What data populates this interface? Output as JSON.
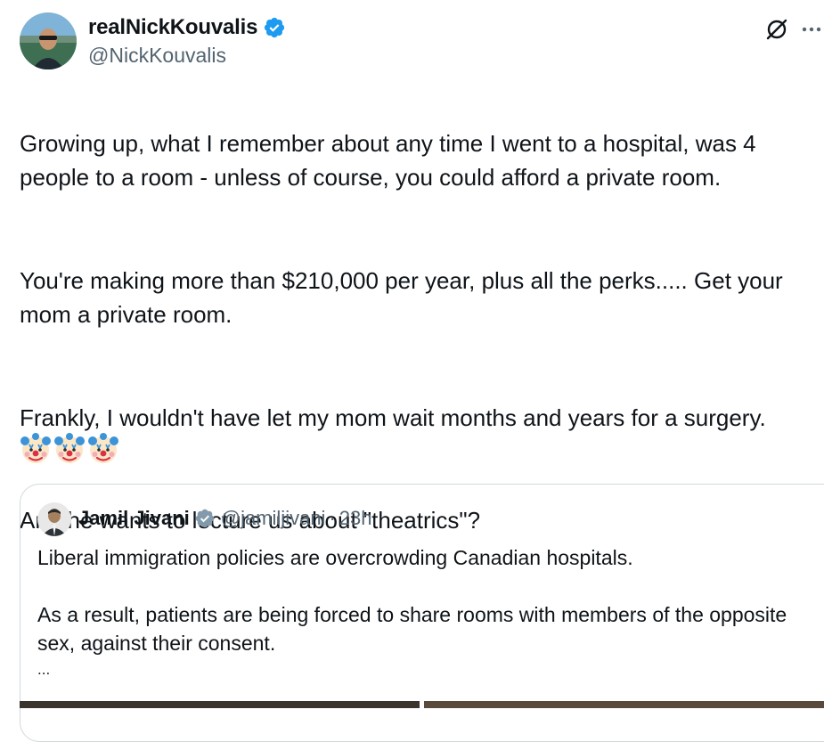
{
  "tweet": {
    "display_name": "realNickKouvalis",
    "handle": "@NickKouvalis",
    "paragraphs": [
      "Growing up, what I remember about any time I went to a hospital, was 4 people to a room - unless of course, you could afford a private room.",
      "You're making more than $210,000 per year, plus all the perks..... Get your mom a private room.",
      "Frankly, I wouldn't have let my mom wait months and years for a surgery.",
      "And he wants to lecture us about \"theatrics\"?"
    ],
    "emoji": [
      "clown-face",
      "clown-face",
      "clown-face"
    ]
  },
  "quoted": {
    "display_name": "Jamil Jivani",
    "handle": "@jamiljivani",
    "separator": "·",
    "time": "23h",
    "paragraphs": [
      "Liberal immigration policies are overcrowding Canadian hospitals.",
      "As a result, patients are being forced to share rooms with members of the opposite sex, against their consent."
    ],
    "ellipsis": "..."
  },
  "icons": {
    "verified": "verified-badge-icon",
    "grok": "grok-icon",
    "more": "more-options-icon"
  },
  "colors": {
    "verified_blue": "#1d9bf0",
    "verified_gray": "#829aab",
    "text_primary": "#0f1419",
    "text_secondary": "#536471",
    "border": "#cfd9de"
  }
}
